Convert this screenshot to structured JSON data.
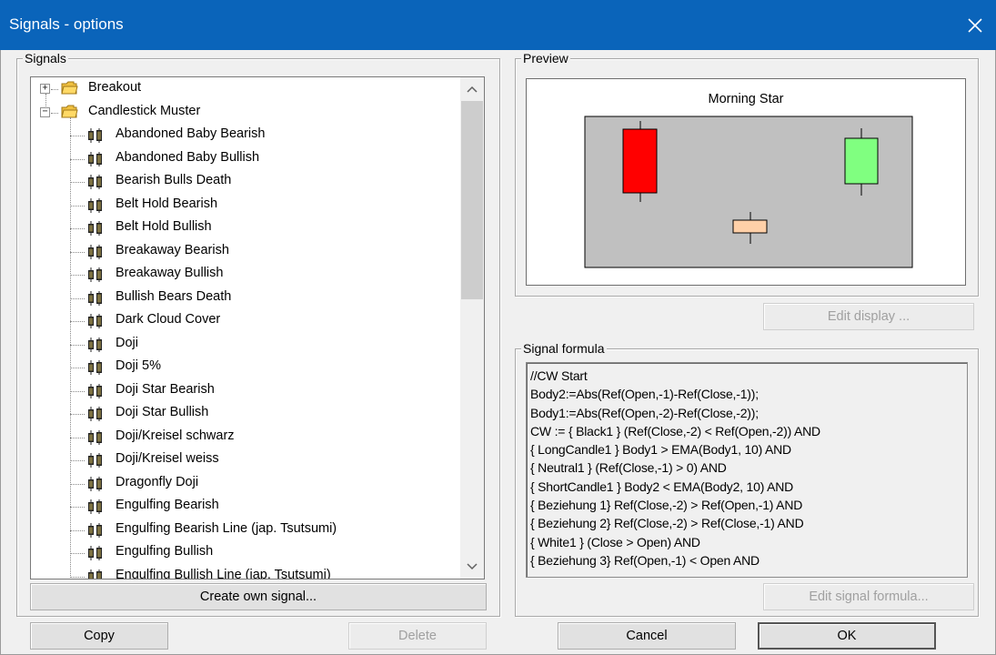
{
  "window": {
    "title": "Signals - options"
  },
  "signals_group": {
    "legend": "Signals",
    "tree": [
      {
        "label": "Breakout",
        "kind": "folder",
        "expander": "+"
      },
      {
        "label": "Candlestick Muster",
        "kind": "folder",
        "expander": "−"
      },
      {
        "label": "Abandoned Baby Bearish",
        "kind": "signal"
      },
      {
        "label": "Abandoned Baby Bullish",
        "kind": "signal"
      },
      {
        "label": "Bearish Bulls Death",
        "kind": "signal"
      },
      {
        "label": "Belt Hold Bearish",
        "kind": "signal"
      },
      {
        "label": "Belt Hold Bullish",
        "kind": "signal"
      },
      {
        "label": "Breakaway Bearish",
        "kind": "signal"
      },
      {
        "label": "Breakaway Bullish",
        "kind": "signal"
      },
      {
        "label": "Bullish Bears Death",
        "kind": "signal"
      },
      {
        "label": "Dark Cloud Cover",
        "kind": "signal"
      },
      {
        "label": "Doji",
        "kind": "signal"
      },
      {
        "label": "Doji 5%",
        "kind": "signal"
      },
      {
        "label": "Doji Star Bearish",
        "kind": "signal"
      },
      {
        "label": "Doji Star Bullish",
        "kind": "signal"
      },
      {
        "label": "Doji/Kreisel schwarz",
        "kind": "signal"
      },
      {
        "label": "Doji/Kreisel weiss",
        "kind": "signal"
      },
      {
        "label": "Dragonfly Doji",
        "kind": "signal"
      },
      {
        "label": "Engulfing Bearish",
        "kind": "signal"
      },
      {
        "label": "Engulfing Bearish Line (jap. Tsutsumi)",
        "kind": "signal"
      },
      {
        "label": "Engulfing Bullish",
        "kind": "signal"
      },
      {
        "label": "Engulfing Bullish Line (jap. Tsutsumi)",
        "kind": "signal"
      }
    ],
    "create_button": "Create own signal..."
  },
  "preview_group": {
    "legend": "Preview",
    "chart_title": "Morning Star",
    "edit_display_button": "Edit display ..."
  },
  "formula_group": {
    "legend": "Signal formula",
    "lines": [
      "//CW Start",
      "Body2:=Abs(Ref(Open,-1)-Ref(Close,-1));",
      "Body1:=Abs(Ref(Open,-2)-Ref(Close,-2));",
      "CW := { Black1 } (Ref(Close,-2) < Ref(Open,-2)) AND",
      "{ LongCandle1 } Body1 > EMA(Body1, 10) AND",
      "{ Neutral1 } (Ref(Close,-1) > 0) AND",
      "{ ShortCandle1 } Body2 < EMA(Body2, 10) AND",
      "{ Beziehung 1} Ref(Close,-2) > Ref(Open,-1) AND",
      "{ Beziehung 2} Ref(Close,-2) > Ref(Close,-1) AND",
      "{ White1 } (Close > Open) AND",
      "{ Beziehung 3} Ref(Open,-1) < Open AND"
    ],
    "edit_formula_button": "Edit signal formula..."
  },
  "footer": {
    "copy": "Copy",
    "delete": "Delete",
    "cancel": "Cancel",
    "ok": "OK"
  },
  "colors": {
    "titlebar": "#0a64ba",
    "bearish_candle": "#ff0000",
    "bullish_candle": "#80ff80",
    "neutral_candle": "#ffd0a8",
    "chart_bg": "#c0c0c0"
  },
  "icons": {
    "close": "close-icon",
    "folder": "folder-icon",
    "signal": "candlestick-icon",
    "scroll_up": "chevron-up-icon",
    "scroll_down": "chevron-down-icon"
  }
}
